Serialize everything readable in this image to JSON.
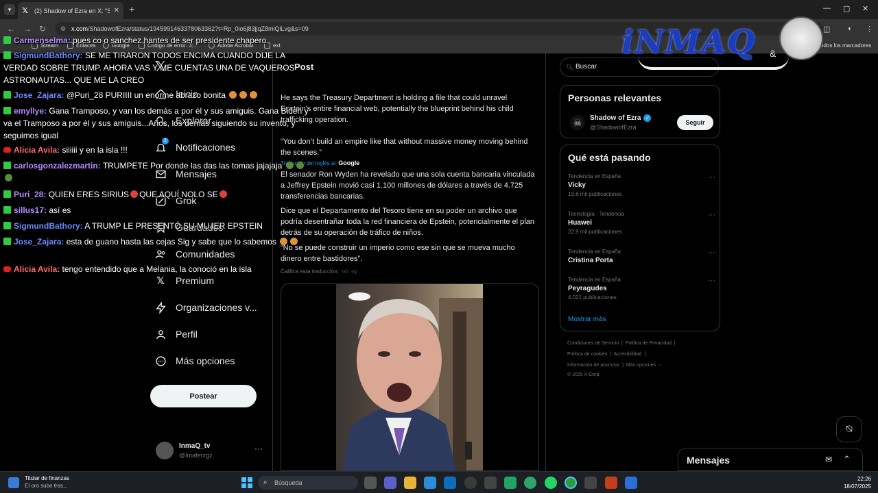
{
  "browser": {
    "tab_title": "(2) Shadow of Ezra en X: \"Sena",
    "url_domain": "x.com",
    "url_path": "/ShadowofEzra/status/1945991463378063362?t=Rp_0io6j83jjqZ8miQlLvg&s=09",
    "bookmarks": [
      "Stream",
      "Enlaces",
      "Google",
      "Código de error: 3:...",
      "Adobe Acrobat",
      "ext"
    ],
    "all_bookmarks": "Todos los marcadores"
  },
  "logo": {
    "text_main": "iNMAQ",
    "ampersand": "&"
  },
  "chat": [
    {
      "icon": "kick",
      "user": "Carmenselma:",
      "user_color": "#b48cff",
      "text": "pues co o sanchez hantes de ser presidente chapero"
    },
    {
      "icon": "kick",
      "user": "SigmundBathory:",
      "user_color": "#6b8bff",
      "text": "SE ME TIRARON TODOS ENCIMA CUANDO DIJE LA VERDAD SOBRE TRUMP. AHORA VAS Y ME CUENTAS UNA DE VAQUEROS ASTRONAUTAS... QUE ME LA CREO"
    },
    {
      "icon": "kick",
      "user": "Jose_Zajara:",
      "user_color": "#6b8bff",
      "text": "@Puri_28 PURIIII un enorme abrazo bonita"
    },
    {
      "icon": "kick",
      "user": "emyllye:",
      "user_color": "#b48cff",
      "text": "Gana Tramposo, y van los demás a por él y sus amiguis. Gana Biden y va el Tramposo a por él y sus amiguis...Años, los demás siguiendo su invento, y seguimos igual"
    },
    {
      "icon": "youtube",
      "user": "Alicia Avila:",
      "user_color": "#ff6b6b",
      "text": "siiiiii y en la isla !!!"
    },
    {
      "icon": "kick",
      "user": "carlosgonzalezmartin:",
      "user_color": "#b48cff",
      "text": "TRUMPETE Por donde las das las tomas jajajaja"
    },
    {
      "icon": "kick",
      "user": "Puri_28:",
      "user_color": "#b48cff",
      "text": "QUIEN ERES SIRIUS"
    },
    {
      "icon": "kick",
      "user": "sillus17:",
      "user_color": "#b48cff",
      "text": "así es"
    },
    {
      "icon": "kick",
      "user": "SigmundBathory:",
      "user_color": "#6b8bff",
      "text": "A TRUMP LE PRESENTÓ SU MUJER EPSTEIN"
    },
    {
      "icon": "kick",
      "user": "Jose_Zajara:",
      "user_color": "#6b8bff",
      "text": "esta de guano hasta las cejas Sig y sabe que lo sabemos"
    },
    {
      "icon": "youtube",
      "user": "Alicia Avila:",
      "user_color": "#ff6b6b",
      "text": "tengo entendido que a Melania, la conoció en la isla"
    }
  ],
  "chat_inline": {
    "puri_mid": "QUE AQUÍ NOLO SE"
  },
  "nav": {
    "items": [
      "Inicio",
      "Explorar",
      "Notificaciones",
      "Mensajes",
      "Grok",
      "Guardados",
      "Comunidades",
      "Premium",
      "Organizaciones v...",
      "Perfil",
      "Más opciones"
    ],
    "notif_badge": "2",
    "post_button": "Postear",
    "account_name": "InmaQ_tv",
    "account_handle": "@Imaferzgz"
  },
  "post": {
    "header": "Post",
    "en_p1": "He says the Treasury Department is holding a file that could unravel Epstein's entire financial web, potentially the blueprint behind his child trafficking operation.",
    "en_p2": "“You don’t build an empire like that without massive money moving behind the scenes.”",
    "translated_label": "Traducido del Inglés al",
    "translated_by": "Google",
    "es_p1": "El senador Ron Wyden ha revelado que una sola cuenta bancaria vinculada a Jeffrey Epstein movió casi 1.100 millones de dólares a través de 4.725 transferencias bancarias.",
    "es_p2": "Dice que el Departamento del Tesoro tiene en su poder un archivo que podría desentrañar toda la red financiera de Epstein, potencialmente el plan detrás de su operación de tráfico de niños.",
    "es_p3": "“No se puede construir un imperio como ese sin que se mueva mucho dinero entre bastidores”.",
    "rate_label": "Califica esta traducción:"
  },
  "right": {
    "search_placeholder": "Buscar",
    "relevant_title": "Personas relevantes",
    "relevant_name": "Shadow of Ezra",
    "relevant_handle": "@ShadowofEzra",
    "follow_label": "Seguir",
    "trending_title": "Qué está pasando",
    "trends": [
      {
        "context": "Tendencia en España",
        "name": "Vicky",
        "count": "19,6 mil publicaciones"
      },
      {
        "context": "Tecnología · Tendencia",
        "name": "Huawei",
        "count": "22,9 mil publicaciones"
      },
      {
        "context": "Tendencia en España",
        "name": "Cristina Porta",
        "count": ""
      },
      {
        "context": "Tendencia en España",
        "name": "Peyragudes",
        "count": "4.021 publicaciones"
      }
    ],
    "show_more": "Mostrar más",
    "footer": [
      "Condiciones de Servicio",
      "Política de Privacidad",
      "Política de cookies",
      "Accesibilidad",
      "Información de anuncios",
      "Más opciones ···",
      "© 2025 X Corp."
    ],
    "messages_title": "Mensajes"
  },
  "taskbar": {
    "weather_title": "Titular de finanzas",
    "weather_sub": "El oro sube tras...",
    "search_placeholder": "Búsqueda",
    "time": "22:26",
    "date": "18/07/2025"
  }
}
